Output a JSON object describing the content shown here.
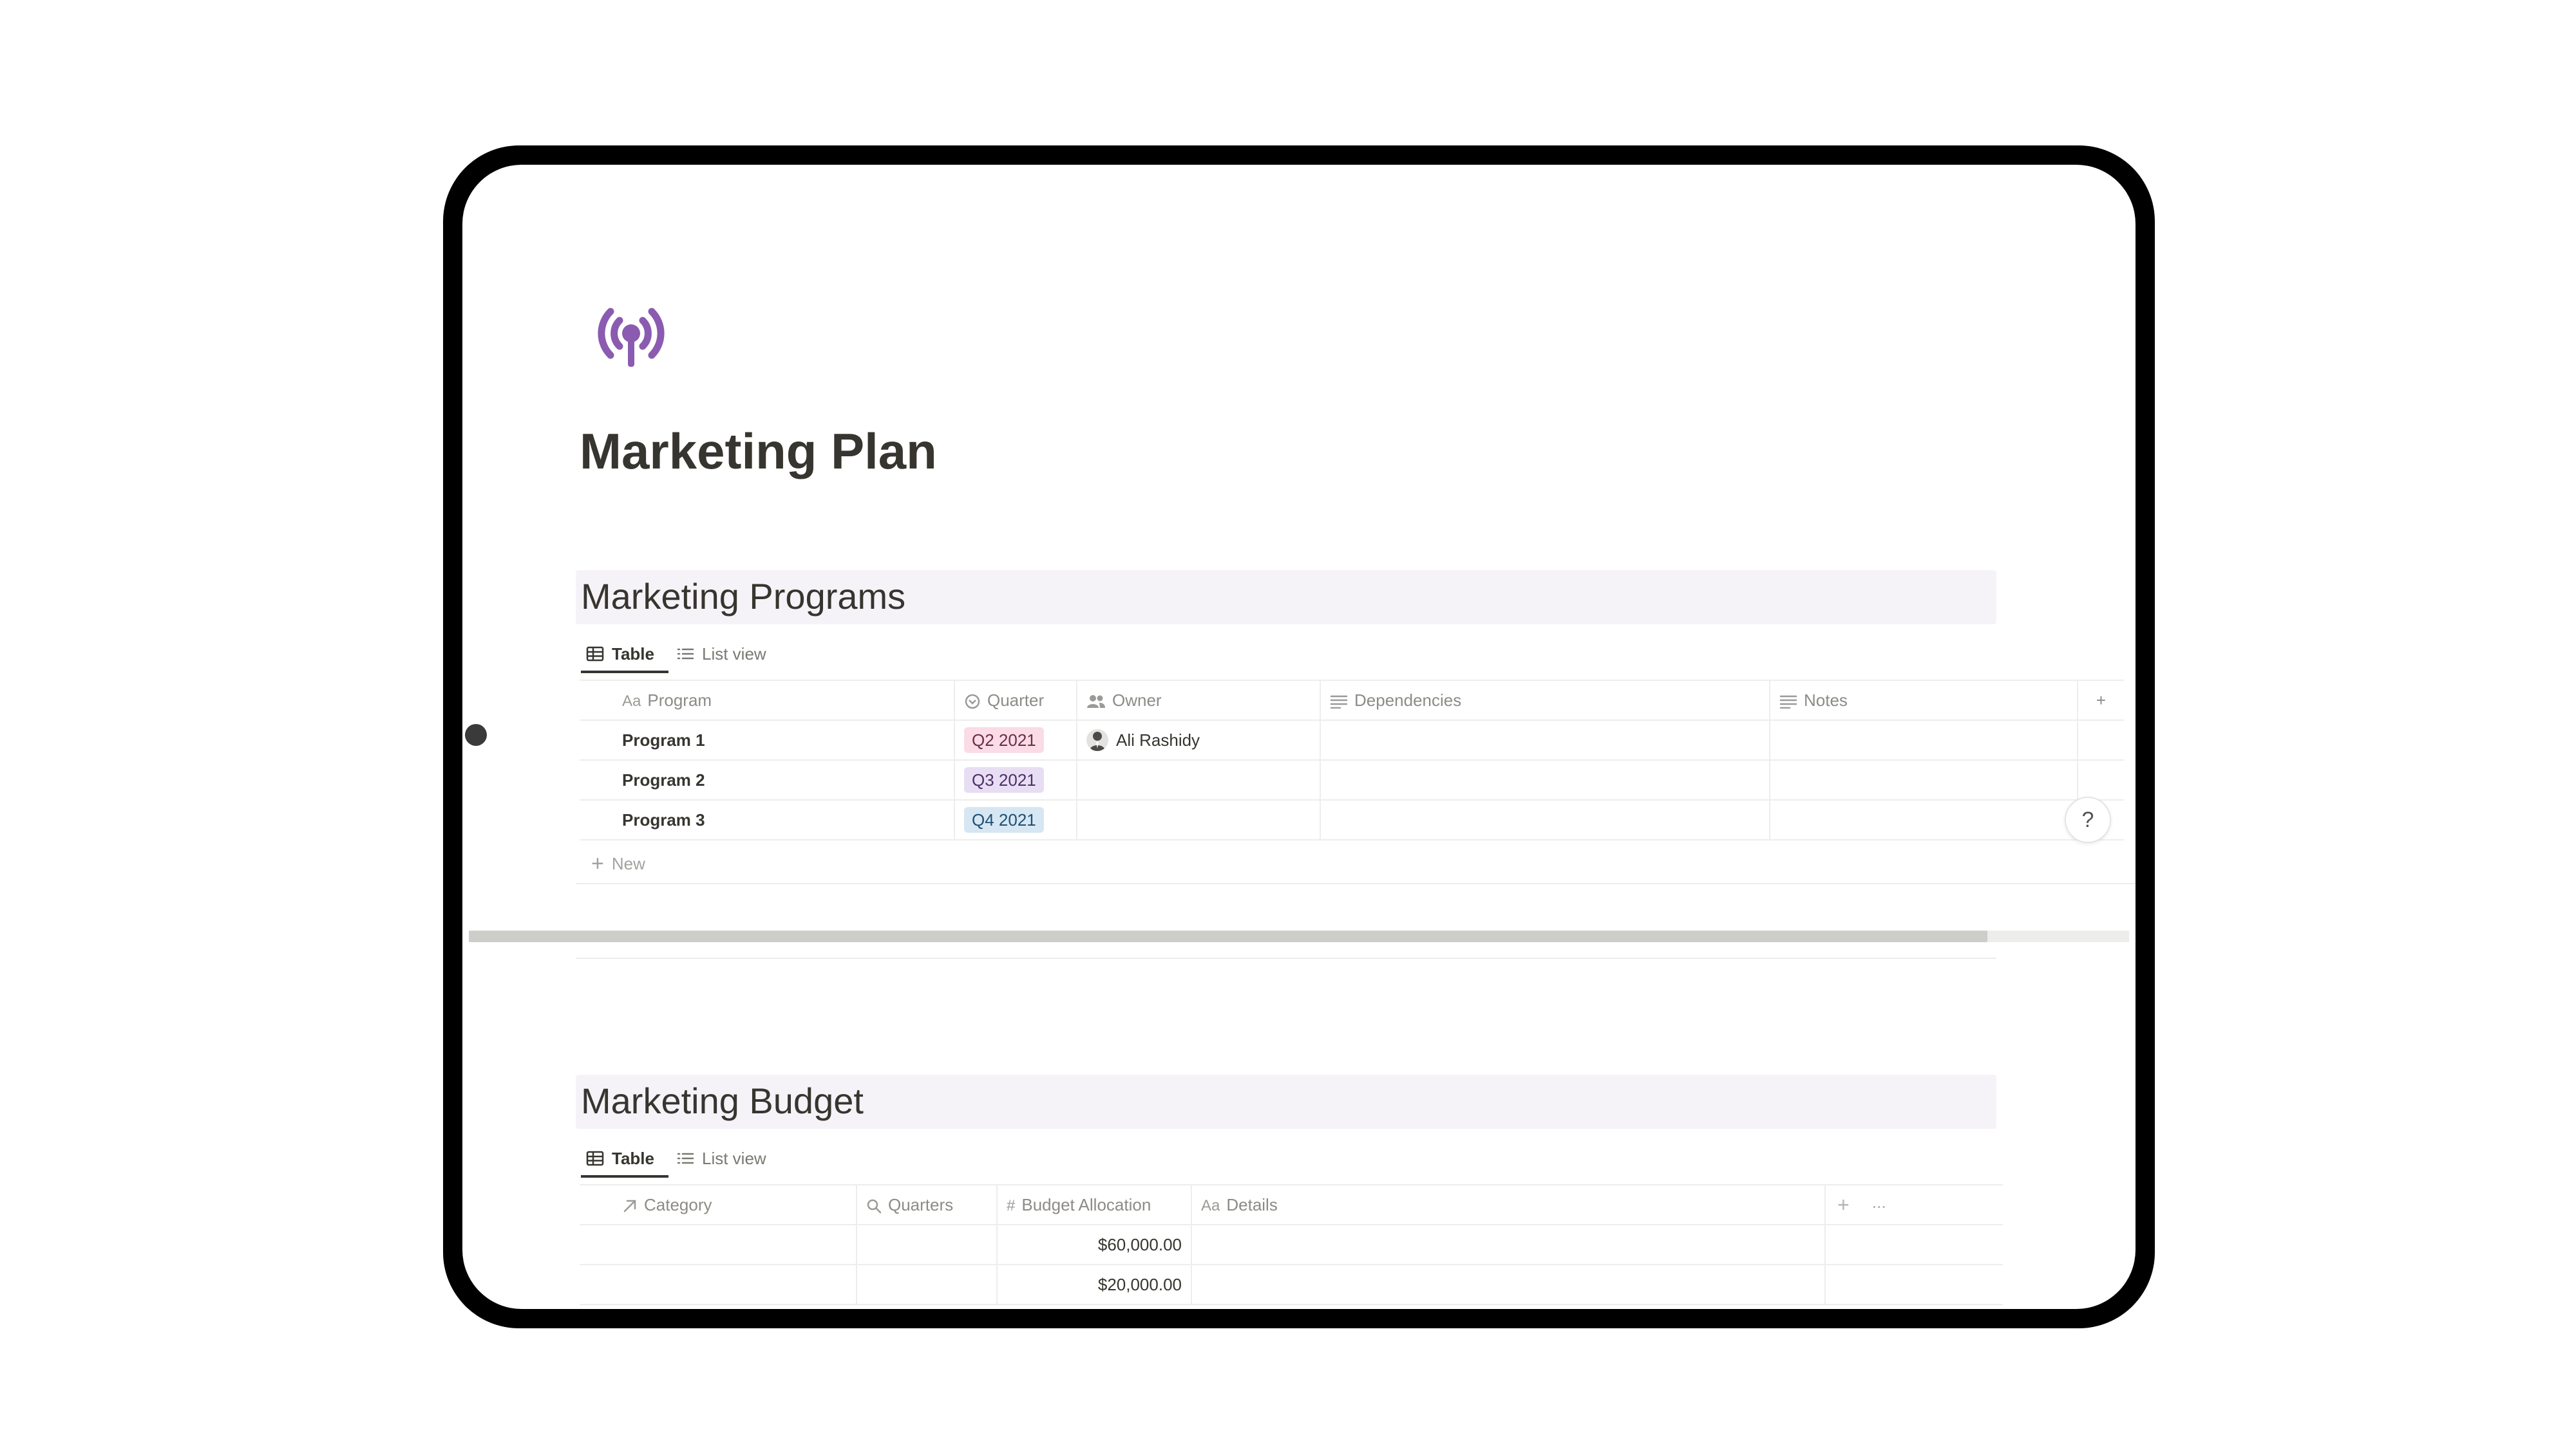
{
  "page": {
    "title": "Marketing Plan",
    "icon": "broadcast-antenna-icon",
    "icon_color": "#8a5bb0"
  },
  "programs": {
    "title": "Marketing Programs",
    "views": [
      {
        "label": "Table",
        "icon": "table-icon",
        "active": true
      },
      {
        "label": "List view",
        "icon": "list-icon",
        "active": false
      }
    ],
    "columns": [
      {
        "icon": "Aa",
        "label": "Program"
      },
      {
        "icon": "select-icon",
        "label": "Quarter"
      },
      {
        "icon": "people-icon",
        "label": "Owner"
      },
      {
        "icon": "text-lines-icon",
        "label": "Dependencies"
      },
      {
        "icon": "text-lines-icon",
        "label": "Notes"
      }
    ],
    "rows": [
      {
        "program": "Program 1",
        "quarter": "Q2 2021",
        "owner": "Ali Rashidy",
        "dependencies": "",
        "notes": ""
      },
      {
        "program": "Program 2",
        "quarter": "Q3 2021",
        "owner": "",
        "dependencies": "",
        "notes": ""
      },
      {
        "program": "Program 3",
        "quarter": "Q4 2021",
        "owner": "",
        "dependencies": "",
        "notes": ""
      }
    ],
    "new_label": "New",
    "add_column": "+"
  },
  "budget": {
    "title": "Marketing Budget",
    "views": [
      {
        "label": "Table",
        "icon": "table-icon",
        "active": true
      },
      {
        "label": "List view",
        "icon": "list-icon",
        "active": false
      }
    ],
    "columns": [
      {
        "icon": "relation-arrow-icon",
        "label": "Category"
      },
      {
        "icon": "search-icon",
        "label": "Quarters"
      },
      {
        "icon": "#",
        "label": "Budget Allocation"
      },
      {
        "icon": "Aa",
        "label": "Details"
      }
    ],
    "rows": [
      {
        "category": "",
        "quarters": "",
        "allocation": "$60,000.00",
        "details": ""
      },
      {
        "category": "",
        "quarters": "",
        "allocation": "$20,000.00",
        "details": ""
      }
    ],
    "add_column": "+",
    "more": "···"
  },
  "help": {
    "label": "?"
  },
  "colors": {
    "section_bg": "#f5f3f8",
    "tag_q2": "#fadbe6",
    "tag_q3": "#e8def3",
    "tag_q4": "#d6e6f2"
  }
}
